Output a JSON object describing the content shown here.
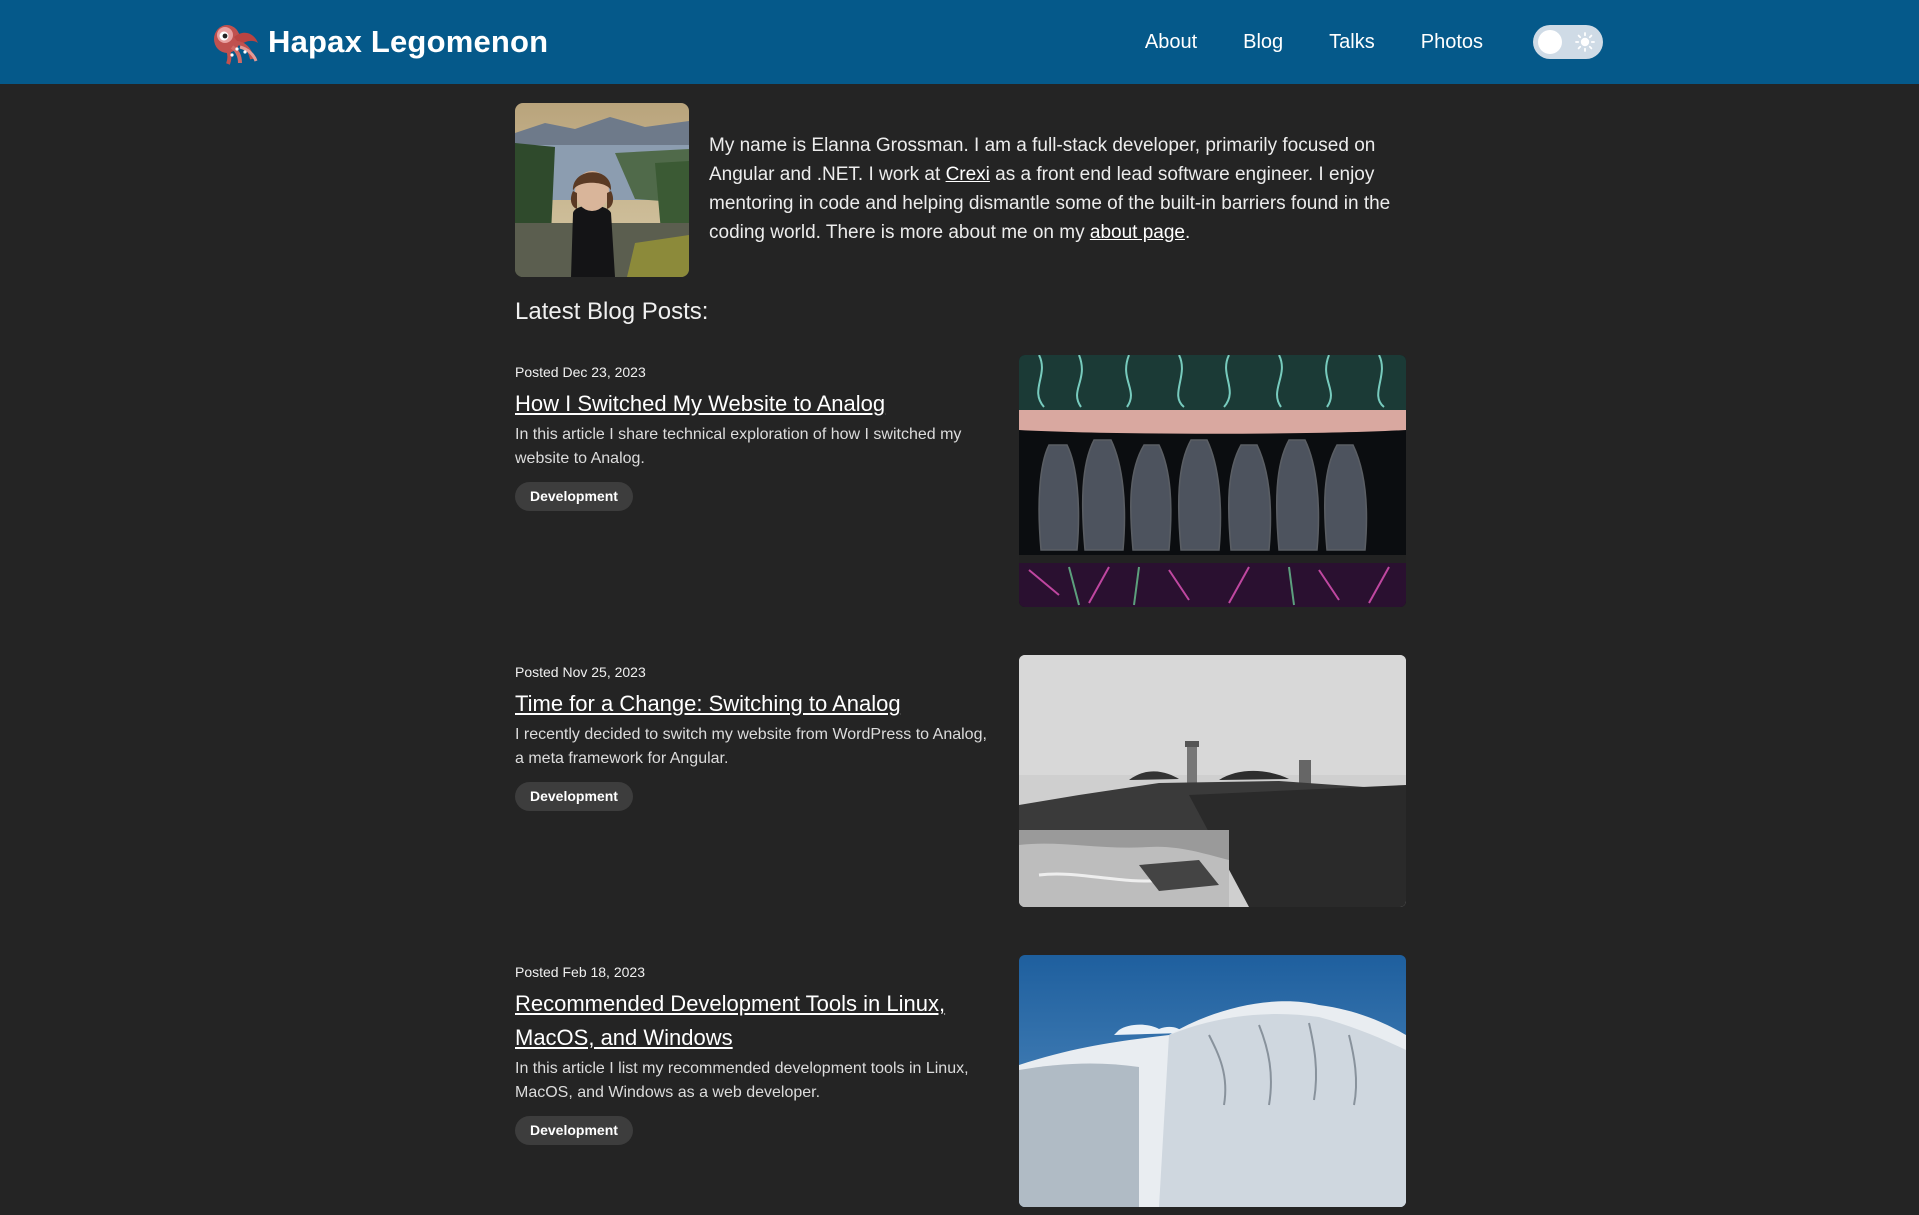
{
  "site": {
    "title": "Hapax Legomenon",
    "logo_icon": "squid-logo-icon"
  },
  "nav": {
    "items": [
      {
        "label": "About"
      },
      {
        "label": "Blog"
      },
      {
        "label": "Talks"
      },
      {
        "label": "Photos"
      }
    ],
    "theme_toggle": {
      "state": "off",
      "icon": "sun-icon"
    }
  },
  "intro": {
    "avatar_alt": "avatar",
    "bio_part1": "My name is Elanna Grossman. I am a full-stack developer, primarily focused on Angular and .NET. I work at ",
    "bio_link1": "Crexi",
    "bio_part2": " as a front end lead software engineer. I enjoy mentoring in code and helping dismantle some of the built-in barriers found in the coding world. There is more about me on my ",
    "bio_link2": "about page",
    "bio_part3": "."
  },
  "blog": {
    "heading": "Latest Blog Posts:",
    "posts": [
      {
        "posted": "Posted Dec 23, 2023",
        "title": "How I Switched My Website to Analog",
        "description": "In this article I share technical exploration of how I switched my website to Analog.",
        "tag": "Development"
      },
      {
        "posted": "Posted Nov 25, 2023",
        "title": "Time for a Change: Switching to Analog",
        "description": "I recently decided to switch my website from WordPress to Analog, a meta framework for Angular.",
        "tag": "Development"
      },
      {
        "posted": "Posted Feb 18, 2023",
        "title": "Recommended Development Tools in Linux, MacOS, and Windows",
        "description": "In this article I list my recommended development tools in Linux, MacOS, and Windows as a web developer.",
        "tag": "Development"
      }
    ]
  },
  "colors": {
    "header_bg": "#05598a",
    "page_bg": "#242424",
    "tag_bg": "#3d3d3d"
  }
}
